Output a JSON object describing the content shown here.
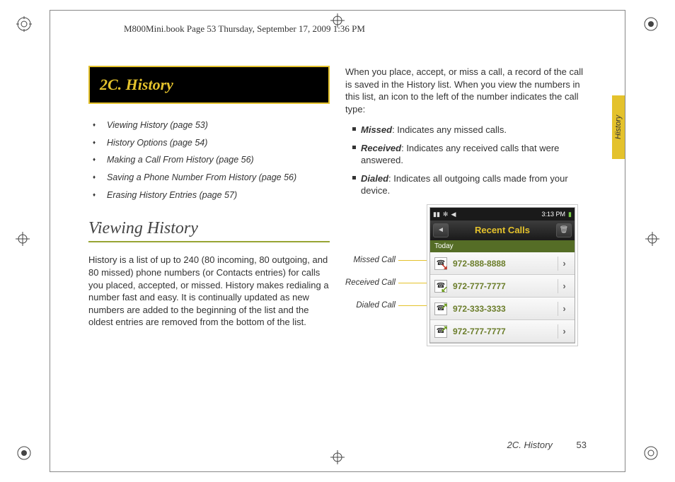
{
  "header_path": "M800Mini.book  Page 53  Thursday, September 17, 2009  1:36 PM",
  "section_title": "2C. History",
  "toc": [
    "Viewing History (page 53)",
    "History Options (page 54)",
    "Making a Call From History (page 56)",
    "Saving a Phone Number From History (page 56)",
    "Erasing History Entries (page 57)"
  ],
  "heading": "Viewing History",
  "para1": "History is a list of up to 240 (80 incoming, 80 outgoing, and 80 missed) phone numbers (or Contacts entries) for calls you placed, accepted, or missed. History makes redialing a number fast and easy. It is continually updated as new numbers are added to the beginning of the list and the oldest entries are removed from the bottom of the list.",
  "para2": "When you place, accept, or miss a call, a record of the call is saved in the History list. When you view the numbers in this list, an icon to the left of the number indicates the call type:",
  "bullets": [
    {
      "term": "Missed",
      "desc": ": Indicates any missed calls."
    },
    {
      "term": "Received",
      "desc": ": Indicates any received calls that were answered."
    },
    {
      "term": "Dialed",
      "desc": ": Indicates all outgoing calls made from your device."
    }
  ],
  "phone": {
    "time": "3:13 PM",
    "title": "Recent Calls",
    "today": "Today",
    "rows": [
      {
        "type": "missed",
        "number": "972-888-8888"
      },
      {
        "type": "received",
        "number": "972-777-7777"
      },
      {
        "type": "dialed",
        "number": "972-333-3333"
      },
      {
        "type": "dialed",
        "number": "972-777-7777"
      }
    ]
  },
  "callouts": {
    "missed": "Missed Call",
    "received": "Received Call",
    "dialed": "Dialed Call"
  },
  "side_tab": "History",
  "footer_section": "2C. History",
  "footer_page": "53"
}
